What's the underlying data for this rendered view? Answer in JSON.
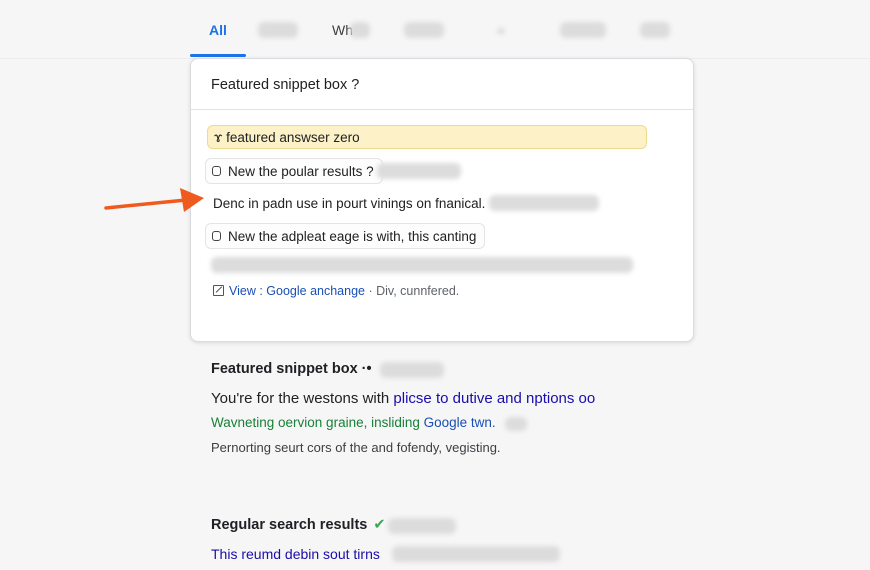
{
  "tabs": {
    "active_label": "All",
    "second_label": "Wh"
  },
  "snippet_card": {
    "title": "Featured snippet box  ?",
    "answer": "ɤ featured answser zero",
    "items": [
      {
        "label": "New the poular results ?"
      },
      {
        "label": "Denc in padn use in pourt vinings on fnanical."
      },
      {
        "label": "New the adpleat eage is with, this canting"
      }
    ],
    "view_link": "View : Google anchange",
    "view_suffix": "· Div, cunnfered."
  },
  "featured_section": {
    "title": "Featured snippet box ·•",
    "headline_blue_start": "You're for the westons with",
    "headline_blue_mid": "plicse",
    "headline_dark_end": "to dutive and nptions oo",
    "green_text": "Wavneting oervion graine, insliding",
    "green_link": "Google twn.",
    "gray_text": "Pernorting seurt cors of the and fofendy, vegisting."
  },
  "regular_section": {
    "title": "Regular search results",
    "check_icon": "check-icon",
    "result_link": "This reumd debin sout tirns"
  },
  "colors": {
    "accent": "#1a73e8",
    "link": "#1a0dab",
    "highlight": "#fdf1c8",
    "arrow": "#ef5a1f",
    "green": "#188038"
  }
}
